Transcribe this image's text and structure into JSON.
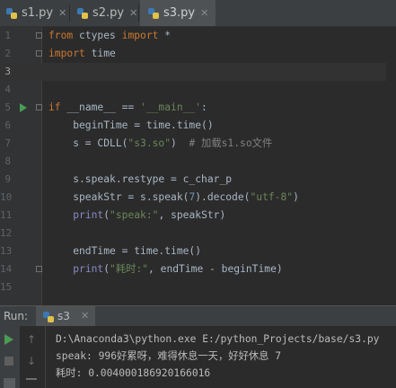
{
  "tabs": [
    {
      "label": "s1.py",
      "active": false
    },
    {
      "label": "s2.py",
      "active": false
    },
    {
      "label": "s3.py",
      "active": true
    }
  ],
  "editor": {
    "line_numbers": [
      "1",
      "2",
      "3",
      "4",
      "5",
      "6",
      "7",
      "8",
      "9",
      "10",
      "11",
      "12",
      "13",
      "14",
      "15"
    ],
    "current_line": 3
  },
  "run_panel": {
    "title": "Run:",
    "tab_label": "s3",
    "output": [
      "D:\\Anaconda3\\python.exe E:/python_Projects/base/s3.py",
      "speak: 996好累呀，难得休息一天，好好休息 7",
      "耗时: 0.004000186920166016"
    ]
  },
  "colors": {
    "keyword": "#cc7832",
    "string": "#6a8759",
    "number": "#6897bb",
    "comment": "#808080",
    "builtin": "#8888c6",
    "run_green": "#499c54"
  }
}
